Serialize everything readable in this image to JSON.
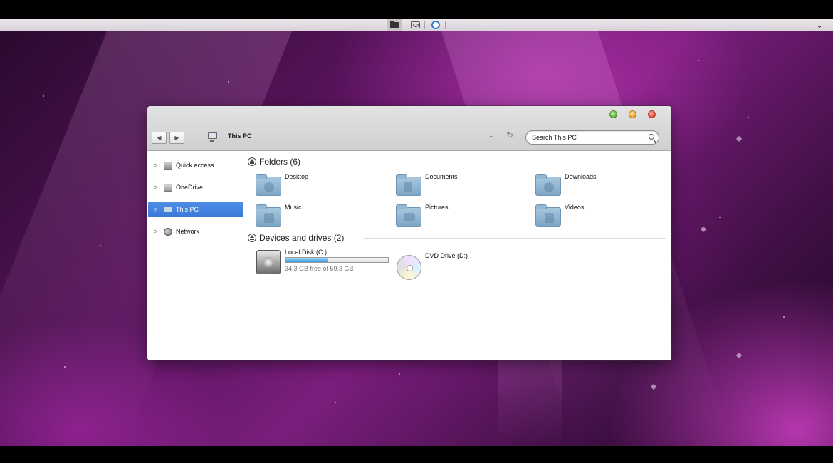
{
  "toolbar": {
    "menu_chevron": "⌄"
  },
  "window": {
    "address": "This PC",
    "search_placeholder": "Search This PC",
    "nav_back": "◀",
    "nav_forward": "▶",
    "address_chevron": "⌄",
    "refresh": "↻"
  },
  "sidebar": {
    "items": [
      {
        "label": "Quick access",
        "icon": "quick-access-icon",
        "selected": false
      },
      {
        "label": "OneDrive",
        "icon": "onedrive-icon",
        "selected": false
      },
      {
        "label": "This PC",
        "icon": "this-pc-icon",
        "selected": true
      },
      {
        "label": "Network",
        "icon": "network-icon",
        "selected": false
      }
    ],
    "chevron": ">",
    "selection_color": "#3b79d9"
  },
  "folders": {
    "title": "Folders (6)",
    "items": [
      {
        "label": "Desktop",
        "icon": "desktop-folder-icon"
      },
      {
        "label": "Documents",
        "icon": "documents-folder-icon"
      },
      {
        "label": "Downloads",
        "icon": "downloads-folder-icon"
      },
      {
        "label": "Music",
        "icon": "music-folder-icon"
      },
      {
        "label": "Pictures",
        "icon": "pictures-folder-icon"
      },
      {
        "label": "Videos",
        "icon": "videos-folder-icon"
      }
    ]
  },
  "devices": {
    "title": "Devices and drives (2)",
    "items": [
      {
        "label": "Local Disk (C:)",
        "free_text": "34.3 GB free of 59.3 GB",
        "used_fraction": 0.42,
        "icon": "hard-drive-icon"
      },
      {
        "label": "DVD Drive (D:)",
        "icon": "dvd-drive-icon"
      }
    ]
  }
}
